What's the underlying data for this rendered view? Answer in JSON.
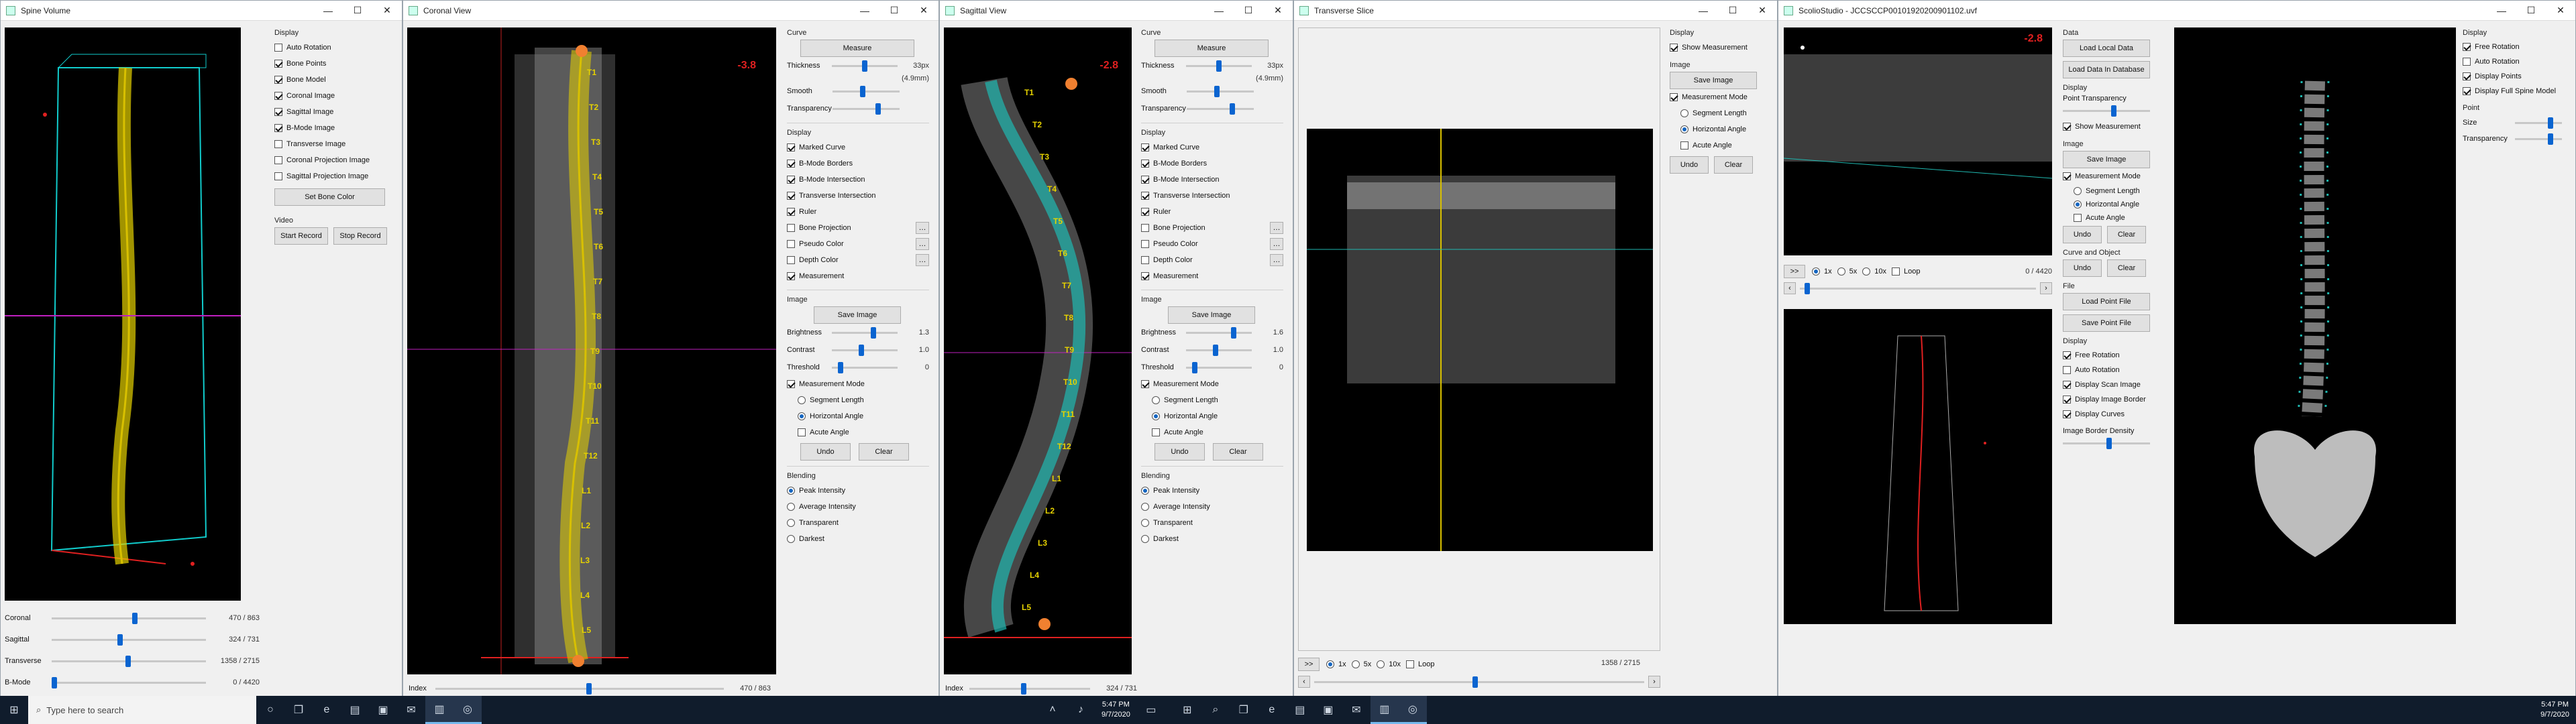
{
  "windows": {
    "spine_volume": {
      "title": "Spine Volume",
      "display_label": "Display",
      "display_options": [
        {
          "label": "Auto Rotation",
          "checked": false
        },
        {
          "label": "Bone Points",
          "checked": true
        },
        {
          "label": "Bone Model",
          "checked": true
        },
        {
          "label": "Coronal Image",
          "checked": true
        },
        {
          "label": "Sagittal Image",
          "checked": true
        },
        {
          "label": "B-Mode Image",
          "checked": true
        },
        {
          "label": "Transverse Image",
          "checked": false
        },
        {
          "label": "Coronal Projection Image",
          "checked": false
        },
        {
          "label": "Sagittal Projection Image",
          "checked": false
        }
      ],
      "set_bone_color": "Set Bone Color",
      "video_label": "Video",
      "start_record": "Start Record",
      "stop_record": "Stop Record",
      "sliders": [
        {
          "label": "Coronal",
          "value": "470 / 863",
          "fraction": 0.545
        },
        {
          "label": "Sagittal",
          "value": "324 / 731",
          "fraction": 0.443
        },
        {
          "label": "Transverse",
          "value": "1358 / 2715",
          "fraction": 0.5
        },
        {
          "label": "B-Mode",
          "value": "0 / 4420",
          "fraction": 0.0
        }
      ]
    },
    "coronal_view": {
      "title": "Coronal View",
      "angle": "-3.8",
      "index_label": "Index",
      "index_value": "470 / 863",
      "index_fraction": 0.545,
      "vertebra_labels": [
        "T1",
        "T2",
        "T3",
        "T4",
        "T5",
        "T6",
        "T7",
        "T8",
        "T9",
        "T10",
        "T11",
        "T12",
        "L1",
        "L2",
        "L3",
        "L4",
        "L5"
      ],
      "curve_label": "Curve",
      "measure": "Measure",
      "thickness_label": "Thickness",
      "thickness_value": "33px",
      "thickness_mm": "(4.9mm)",
      "thickness_fraction": 0.5,
      "smooth_label": "Smooth",
      "smooth_fraction": 0.45,
      "transparency_label": "Transparency",
      "transparency_fraction": 0.7,
      "display_label": "Display",
      "display_options": [
        {
          "label": "Marked Curve",
          "checked": true
        },
        {
          "label": "B-Mode Borders",
          "checked": true
        },
        {
          "label": "B-Mode Intersection",
          "checked": true
        },
        {
          "label": "Transverse Intersection",
          "checked": true
        },
        {
          "label": "Ruler",
          "checked": true
        },
        {
          "label": "Bone Projection",
          "checked": false
        },
        {
          "label": "Pseudo Color",
          "checked": false
        },
        {
          "label": "Depth Color",
          "checked": false
        },
        {
          "label": "Measurement",
          "checked": true
        }
      ],
      "image_label": "Image",
      "save_image": "Save Image",
      "brightness_label": "Brightness",
      "brightness_value": "1.3",
      "brightness_fraction": 0.65,
      "contrast_label": "Contrast",
      "contrast_value": "1.0",
      "contrast_fraction": 0.45,
      "threshold_label": "Threshold",
      "threshold_value": "0",
      "threshold_fraction": 0.1,
      "measurement_mode": "Measurement Mode",
      "measurement_mode_checked": true,
      "segment_length": "Segment Length",
      "horizontal_angle": "Horizontal Angle",
      "acute_angle": "Acute Angle",
      "undo": "Undo",
      "clear": "Clear",
      "blending_label": "Blending",
      "blending_options": [
        {
          "label": "Peak Intensity",
          "checked": true
        },
        {
          "label": "Average Intensity",
          "checked": false
        },
        {
          "label": "Transparent",
          "checked": false
        },
        {
          "label": "Darkest",
          "checked": false
        }
      ]
    },
    "sagittal_view": {
      "title": "Sagittal View",
      "angle": "-2.8",
      "index_label": "Index",
      "index_value": "324 / 731",
      "index_fraction": 0.443,
      "vertebra_labels": [
        "T1",
        "T2",
        "T3",
        "T4",
        "T5",
        "T6",
        "T7",
        "T8",
        "T9",
        "T10",
        "T11",
        "T12",
        "L1",
        "L2",
        "L3",
        "L4",
        "L5"
      ],
      "curve_label": "Curve",
      "measure": "Measure",
      "thickness_label": "Thickness",
      "thickness_value": "33px",
      "thickness_mm": "(4.9mm)",
      "thickness_fraction": 0.5,
      "smooth_label": "Smooth",
      "smooth_fraction": 0.45,
      "transparency_label": "Transparency",
      "transparency_fraction": 0.7,
      "display_label": "Display",
      "display_options": [
        {
          "label": "Marked Curve",
          "checked": true
        },
        {
          "label": "B-Mode Borders",
          "checked": true
        },
        {
          "label": "B-Mode Intersection",
          "checked": true
        },
        {
          "label": "Transverse Intersection",
          "checked": true
        },
        {
          "label": "Ruler",
          "checked": true
        },
        {
          "label": "Bone Projection",
          "checked": false
        },
        {
          "label": "Pseudo Color",
          "checked": false
        },
        {
          "label": "Depth Color",
          "checked": false
        },
        {
          "label": "Measurement",
          "checked": true
        }
      ],
      "image_label": "Image",
      "save_image": "Save Image",
      "brightness_label": "Brightness",
      "brightness_value": "1.6",
      "brightness_fraction": 0.75,
      "contrast_label": "Contrast",
      "contrast_value": "1.0",
      "contrast_fraction": 0.45,
      "threshold_label": "Threshold",
      "threshold_value": "0",
      "threshold_fraction": 0.1,
      "measurement_mode": "Measurement Mode",
      "measurement_mode_checked": true,
      "segment_length": "Segment Length",
      "horizontal_angle": "Horizontal Angle",
      "acute_angle": "Acute Angle",
      "undo": "Undo",
      "clear": "Clear",
      "blending_label": "Blending",
      "blending_options": [
        {
          "label": "Peak Intensity",
          "checked": true
        },
        {
          "label": "Average Intensity",
          "checked": false
        },
        {
          "label": "Transparent",
          "checked": false
        },
        {
          "label": "Darkest",
          "checked": false
        }
      ]
    },
    "transverse_slice": {
      "title": "Transverse Slice",
      "display_label": "Display",
      "show_measurement": "Show Measurement",
      "show_measurement_checked": true,
      "image_label": "Image",
      "save_image": "Save Image",
      "measurement_mode": "Measurement Mode",
      "segment_length": "Segment Length",
      "horizontal_angle": "Horizontal Angle",
      "acute_angle": "Acute Angle",
      "undo": "Undo",
      "clear": "Clear",
      "play": ">>",
      "speeds": [
        "1x",
        "5x",
        "10x"
      ],
      "loop": "Loop",
      "frame_value": "1358 / 2715",
      "frame_fraction": 0.5
    },
    "scoliostudio": {
      "title": "ScolioStudio - JCCSCCP00101920200901102.uvf",
      "angle": "-2.8",
      "play": ">>",
      "speeds": [
        "1x",
        "5x",
        "10x"
      ],
      "loop": "Loop",
      "frame_value": "0 / 4420",
      "data_label": "Data",
      "load_local_data": "Load Local Data",
      "load_data_db": "Load Data In Database",
      "display_label": "Display",
      "point_transparency": "Point Transparency",
      "show_measurement": "Show Measurement",
      "image_label": "Image",
      "save_image": "Save Image",
      "measurement_mode": "Measurement Mode",
      "segment_length": "Segment Length",
      "horizontal_angle": "Horizontal Angle",
      "acute_angle": "Acute Angle",
      "undo": "Undo",
      "clear": "Clear",
      "curve_object_label": "Curve and Object",
      "file_label": "File",
      "load_point_file": "Load Point File",
      "save_point_file": "Save Point File",
      "display2_label": "Display",
      "display2_options": [
        {
          "label": "Free Rotation",
          "checked": true
        },
        {
          "label": "Auto Rotation",
          "checked": false
        },
        {
          "label": "Display Scan Image",
          "checked": true
        },
        {
          "label": "Display Image Border",
          "checked": true
        },
        {
          "label": "Display Curves",
          "checked": true
        }
      ],
      "image_border_density": "Image Border Density",
      "right_display_label": "Display",
      "right_display_options": [
        {
          "label": "Free Rotation",
          "checked": true
        },
        {
          "label": "Auto Rotation",
          "checked": false
        },
        {
          "label": "Display Points",
          "checked": true
        },
        {
          "label": "Display Full Spine Model",
          "checked": true
        }
      ],
      "point_label": "Point",
      "size_label": "Size",
      "transparency_label": "Transparency"
    }
  },
  "taskbar": {
    "search_placeholder": "Type here to search",
    "time1": "5:47 PM",
    "date1": "9/7/2020",
    "time2": "5:47 PM",
    "date2": "9/7/2020"
  },
  "colors": {
    "accent": "#0a64d0",
    "yellow_curve": "#e6d200",
    "teal_curve": "#1fb8b0",
    "red_marker": "#e02020",
    "magenta_line": "#c020c0"
  }
}
